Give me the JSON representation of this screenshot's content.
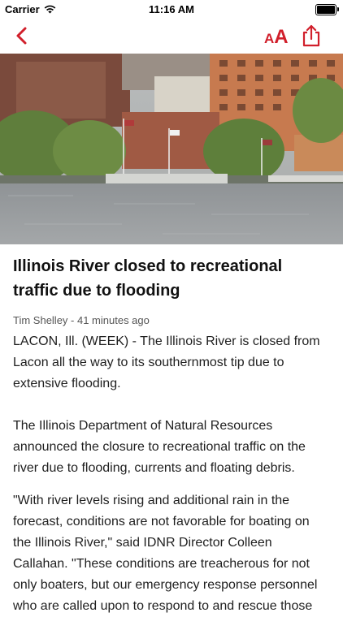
{
  "status_bar": {
    "carrier": "Carrier",
    "time": "11:16 AM",
    "battery_level": 1.0
  },
  "nav": {
    "back_icon": "chevron-left-icon",
    "text_size_small": "A",
    "text_size_large": "A",
    "share_icon": "share-icon",
    "accent_color": "#d11f2b"
  },
  "article": {
    "headline": "Illinois River closed to recreational traffic due to flooding",
    "byline": "Tim Shelley - 41 minutes ago",
    "paragraphs": [
      "LACON, Ill. (WEEK) - The Illinois River is closed from Lacon all the way to its southernmost tip due to extensive flooding.",
      "The Illinois Department of Natural Resources announced the closure to recreational traffic on the river due to flooding, currents and floating debris.",
      "\"With river levels rising and additional rain in the forecast, conditions are not favorable for boating on the Illinois River,\" said IDNR Director Colleen Callahan. \"These conditions are treacherous for not only boaters, but our emergency response personnel who are called upon to respond to and rescue those"
    ]
  }
}
